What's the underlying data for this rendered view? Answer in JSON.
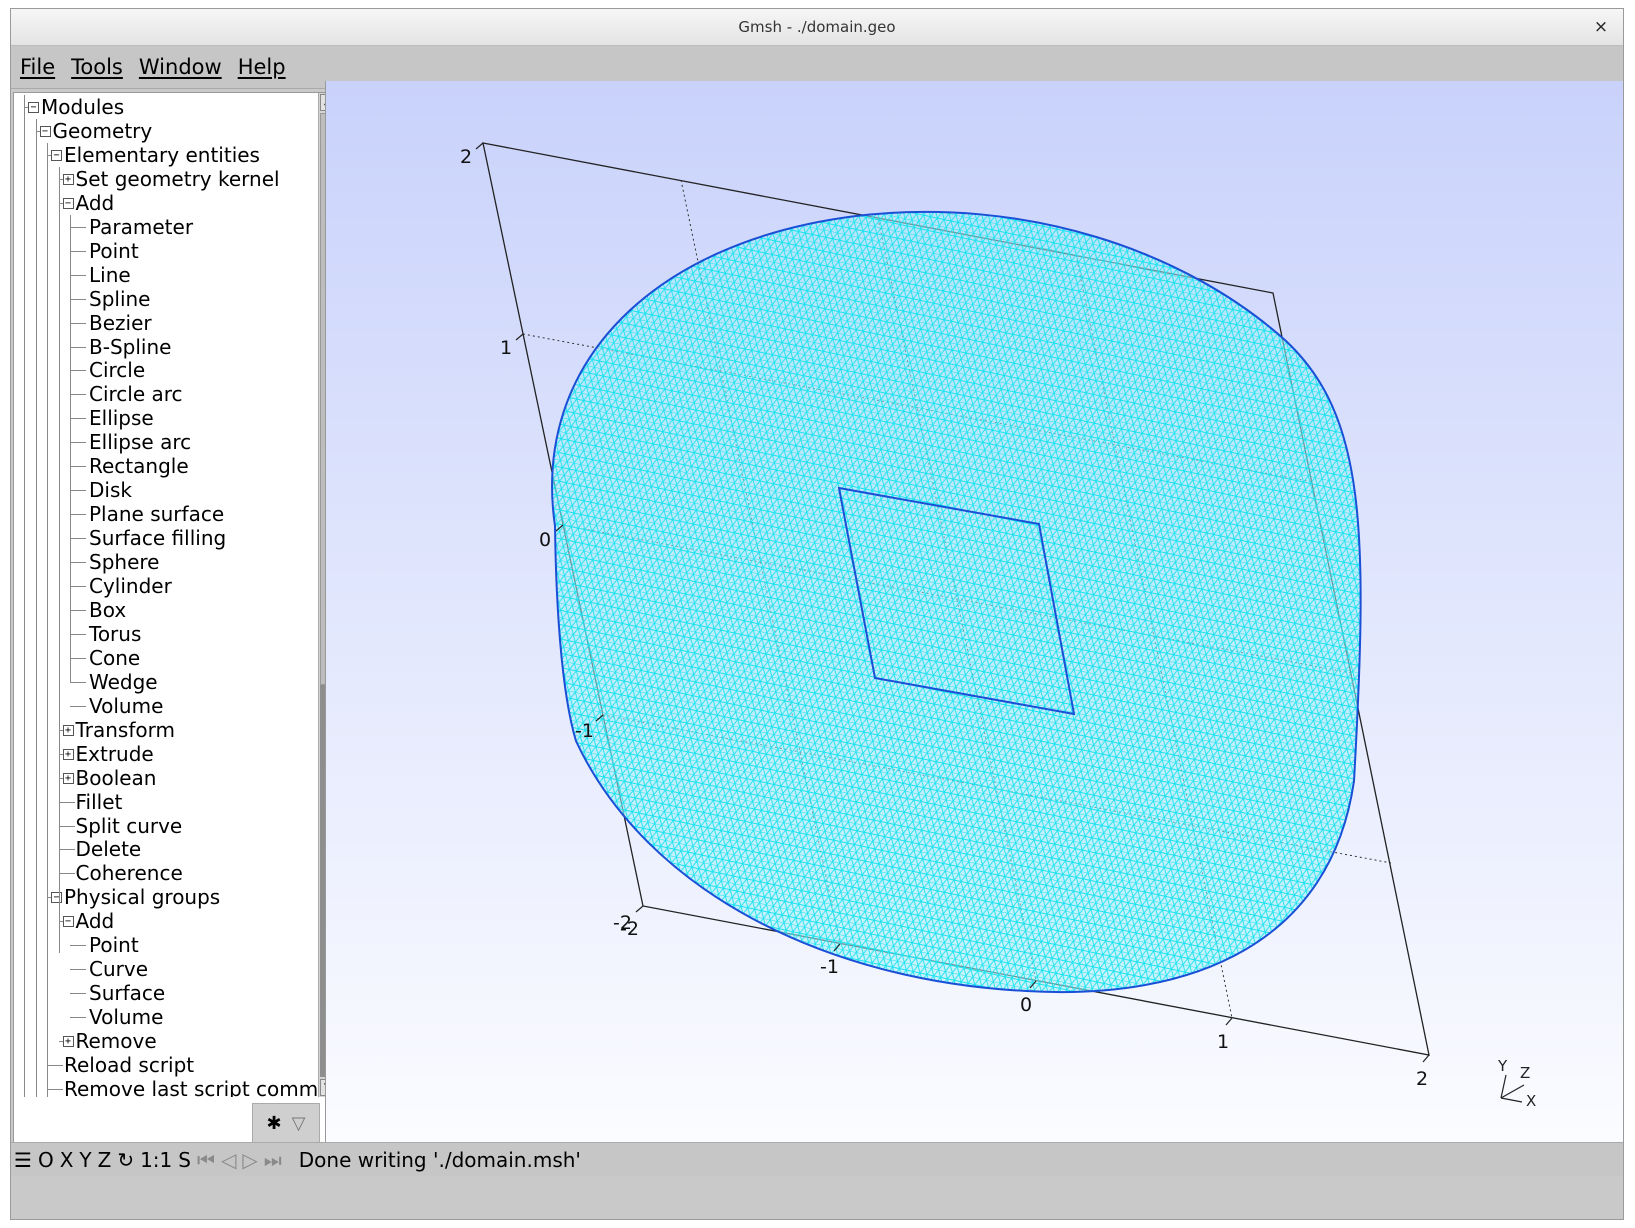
{
  "window": {
    "title": "Gmsh - ./domain.geo",
    "close_glyph": "×"
  },
  "menu": [
    "File",
    "Tools",
    "Window",
    "Help"
  ],
  "tree": {
    "items": [
      {
        "label": "Modules",
        "level": 0,
        "box": "-"
      },
      {
        "label": "Geometry",
        "level": 1,
        "box": "-"
      },
      {
        "label": "Elementary entities",
        "level": 2,
        "box": "-"
      },
      {
        "label": "Set geometry kernel",
        "level": 3,
        "box": "+"
      },
      {
        "label": "Add",
        "level": 3,
        "box": "-"
      },
      {
        "label": "Parameter",
        "level": 4,
        "box": ""
      },
      {
        "label": "Point",
        "level": 4,
        "box": ""
      },
      {
        "label": "Line",
        "level": 4,
        "box": ""
      },
      {
        "label": "Spline",
        "level": 4,
        "box": ""
      },
      {
        "label": "Bezier",
        "level": 4,
        "box": ""
      },
      {
        "label": "B-Spline",
        "level": 4,
        "box": ""
      },
      {
        "label": "Circle",
        "level": 4,
        "box": ""
      },
      {
        "label": "Circle arc",
        "level": 4,
        "box": ""
      },
      {
        "label": "Ellipse",
        "level": 4,
        "box": ""
      },
      {
        "label": "Ellipse arc",
        "level": 4,
        "box": ""
      },
      {
        "label": "Rectangle",
        "level": 4,
        "box": ""
      },
      {
        "label": "Disk",
        "level": 4,
        "box": ""
      },
      {
        "label": "Plane surface",
        "level": 4,
        "box": ""
      },
      {
        "label": "Surface filling",
        "level": 4,
        "box": ""
      },
      {
        "label": "Sphere",
        "level": 4,
        "box": ""
      },
      {
        "label": "Cylinder",
        "level": 4,
        "box": ""
      },
      {
        "label": "Box",
        "level": 4,
        "box": ""
      },
      {
        "label": "Torus",
        "level": 4,
        "box": ""
      },
      {
        "label": "Cone",
        "level": 4,
        "box": ""
      },
      {
        "label": "Wedge",
        "level": 4,
        "box": ""
      },
      {
        "label": "Volume",
        "level": 4,
        "box": ""
      },
      {
        "label": "Transform",
        "level": 3,
        "box": "+"
      },
      {
        "label": "Extrude",
        "level": 3,
        "box": "+"
      },
      {
        "label": "Boolean",
        "level": 3,
        "box": "+"
      },
      {
        "label": "Fillet",
        "level": 3,
        "box": ""
      },
      {
        "label": "Split curve",
        "level": 3,
        "box": ""
      },
      {
        "label": "Delete",
        "level": 3,
        "box": ""
      },
      {
        "label": "Coherence",
        "level": 3,
        "box": ""
      },
      {
        "label": "Physical groups",
        "level": 2,
        "box": "-"
      },
      {
        "label": "Add",
        "level": 3,
        "box": "-"
      },
      {
        "label": "Point",
        "level": 4,
        "box": ""
      },
      {
        "label": "Curve",
        "level": 4,
        "box": ""
      },
      {
        "label": "Surface",
        "level": 4,
        "box": ""
      },
      {
        "label": "Volume",
        "level": 4,
        "box": ""
      },
      {
        "label": "Remove",
        "level": 3,
        "box": "+"
      },
      {
        "label": "Reload script",
        "level": 2,
        "box": ""
      },
      {
        "label": "Remove last script comm",
        "level": 2,
        "box": ""
      }
    ]
  },
  "status": {
    "buttons": [
      "O",
      "X",
      "Y",
      "Z"
    ],
    "scale": "1:1",
    "s_label": "S",
    "message": "Done writing './domain.msh'"
  },
  "viewport": {
    "axis_labels": {
      "y_top": "2",
      "y_1": "1",
      "y_0": "0",
      "y_m1": "-1",
      "corner": "-2",
      "x_m2": "-2",
      "x_m1": "-1",
      "x_0": "0",
      "x_1": "1",
      "x_2": "2"
    },
    "triad": {
      "y": "Y",
      "z": "Z",
      "x": "X"
    },
    "colors": {
      "mesh": "#19e3ef",
      "mesh_fill": "#a5eef8",
      "boundary": "#1a4fd6",
      "box": "#222222"
    }
  }
}
